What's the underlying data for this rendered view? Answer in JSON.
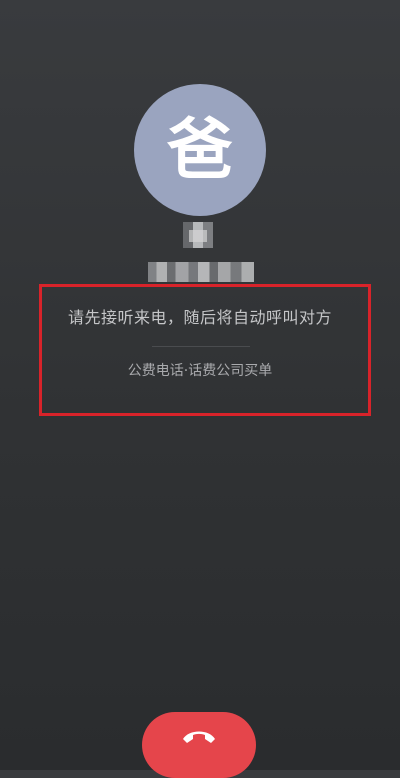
{
  "caller": {
    "avatar_char": "爸",
    "avatar_color": "#9aa4bf",
    "name_obscured": true,
    "number_obscured": true
  },
  "notice": {
    "main_text": "请先接听来电，随后将自动呼叫对方",
    "sub_text": "公费电话·话费公司买单"
  },
  "controls": {
    "hangup_icon": "phone-hangup-icon",
    "hangup_color": "#e5454b"
  },
  "annotation": {
    "highlight_color": "#d8232a"
  }
}
